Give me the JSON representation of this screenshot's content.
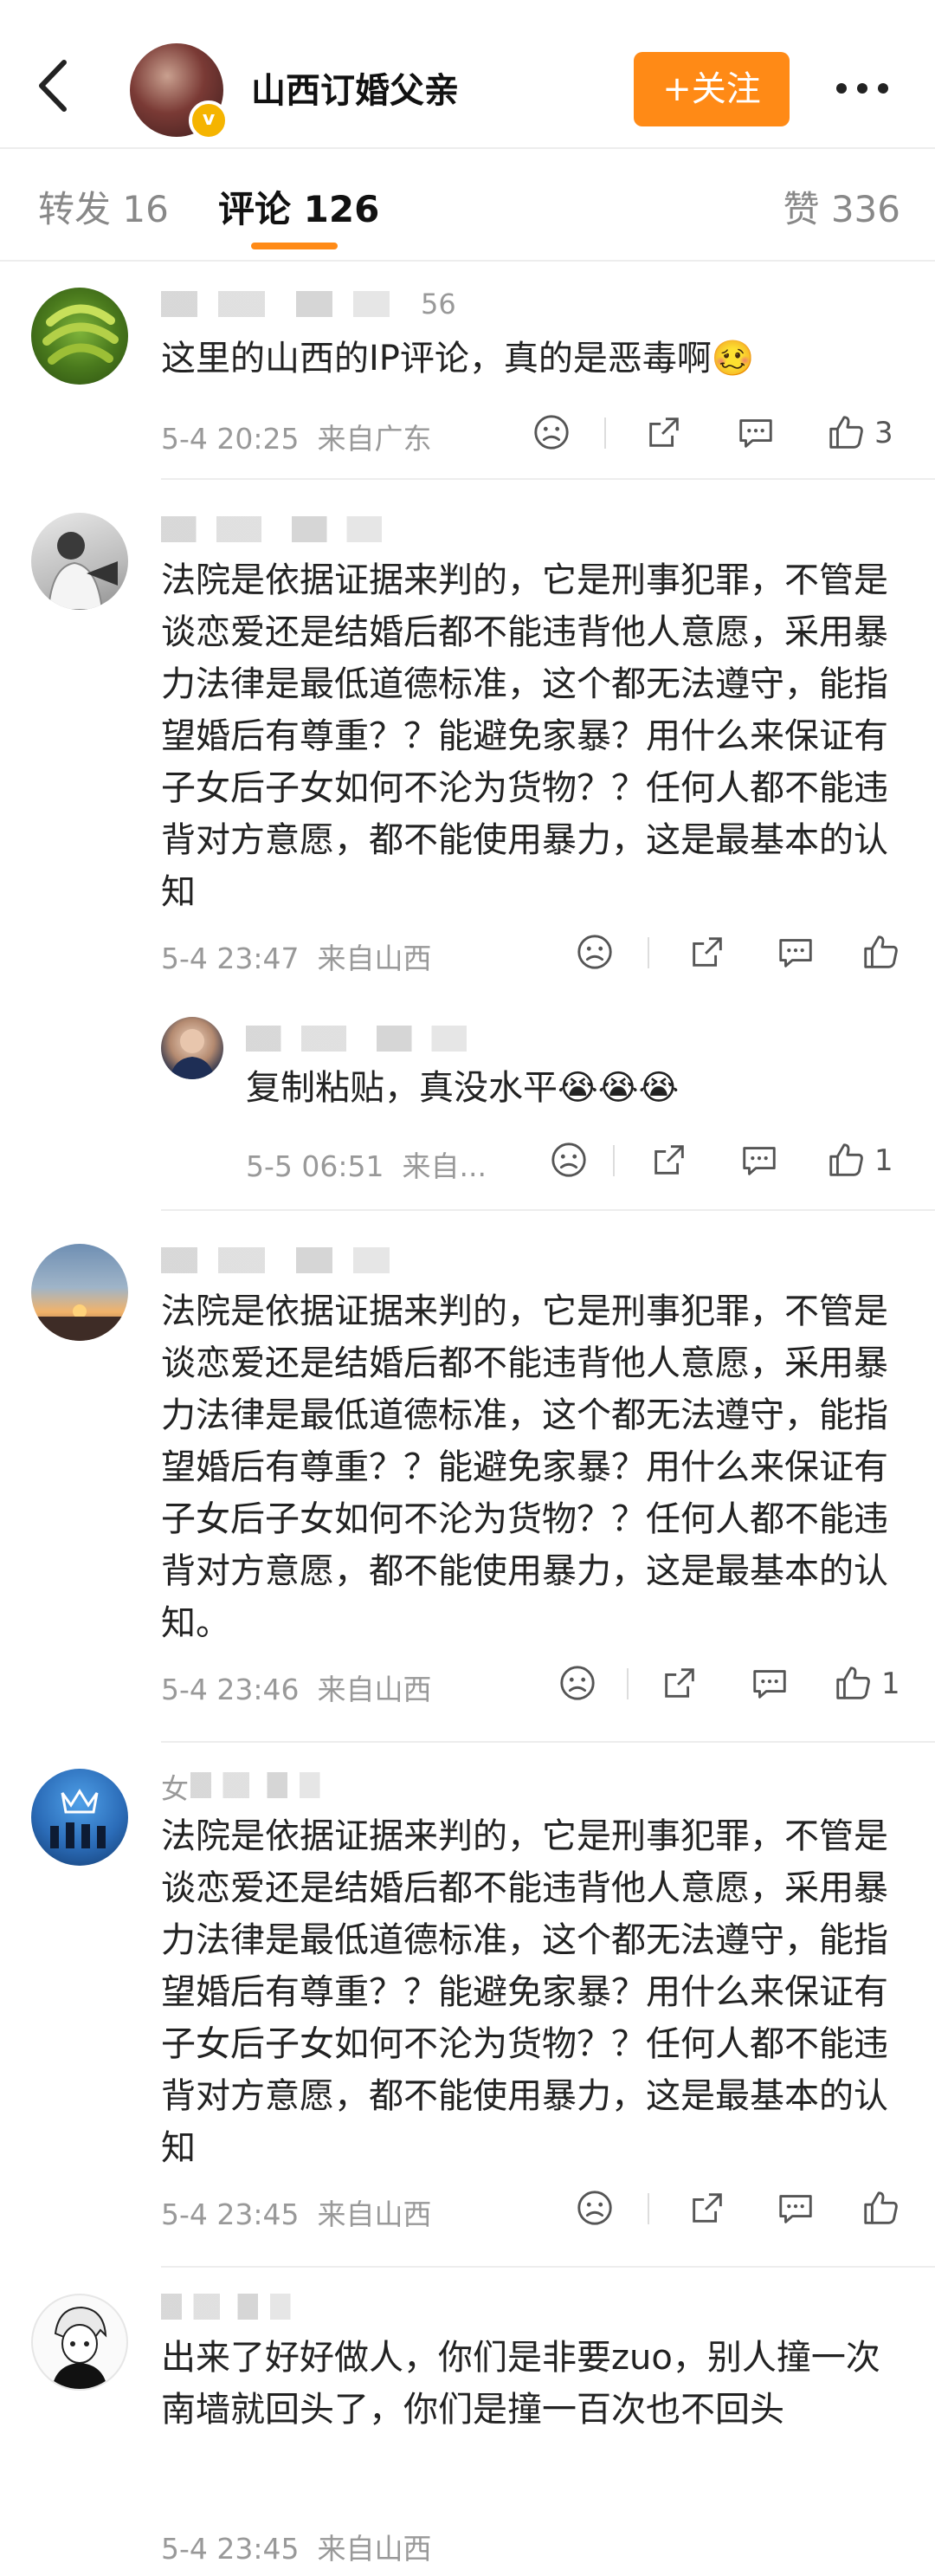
{
  "header": {
    "title": "山西订婚父亲",
    "follow_label": "+关注",
    "verified_badge": "v"
  },
  "tabs": {
    "repost": "转发 16",
    "comments": "评论 126",
    "likes": "赞 336"
  },
  "colors": {
    "accent": "#ff8a16",
    "verified": "#f5b400"
  },
  "comments": [
    {
      "name_partial": "56",
      "text": "这里的山西的IP评论，真的是恶毒啊🥴",
      "time": "5-4 20:25",
      "source": "来自广东",
      "like_count": "3"
    },
    {
      "name_partial": "",
      "text": "法院是依据证据来判的，它是刑事犯罪，不管是谈恋爱还是结婚后都不能违背他人意愿，采用暴力法律是最低道德标准，这个都无法遵守，能指望婚后有尊重？？能避免家暴？用什么来保证有子女后子女如何不沦为货物？？任何人都不能违背对方意愿，都不能使用暴力，这是最基本的认知",
      "time": "5-4 23:47",
      "source": "来自山西",
      "like_count": ""
    },
    {
      "name_partial": "",
      "text": "法院是依据证据来判的，它是刑事犯罪，不管是谈恋爱还是结婚后都不能违背他人意愿，采用暴力法律是最低道德标准，这个都无法遵守，能指望婚后有尊重？？能避免家暴？用什么来保证有子女后子女如何不沦为货物？？任何人都不能违背对方意愿，都不能使用暴力，这是最基本的认知。",
      "time": "5-4 23:46",
      "source": "来自山西",
      "like_count": "1"
    },
    {
      "name_partial": "女",
      "text": "法院是依据证据来判的，它是刑事犯罪，不管是谈恋爱还是结婚后都不能违背他人意愿，采用暴力法律是最低道德标准，这个都无法遵守，能指望婚后有尊重？？能避免家暴？用什么来保证有子女后子女如何不沦为货物？？任何人都不能违背对方意愿，都不能使用暴力，这是最基本的认知",
      "time": "5-4 23:45",
      "source": "来自山西",
      "like_count": ""
    },
    {
      "name_partial": "",
      "text": "出来了好好做人，你们是非要zuo，别人撞一次南墙就回头了，你们是撞一百次也不回头",
      "time": "5-4 23:45",
      "source": "来自山西",
      "like_count": ""
    }
  ],
  "reply": {
    "text": "复制粘贴，真没水平😭😭😭",
    "time": "5-5 06:51",
    "source": "来自...",
    "like_count": "1"
  }
}
